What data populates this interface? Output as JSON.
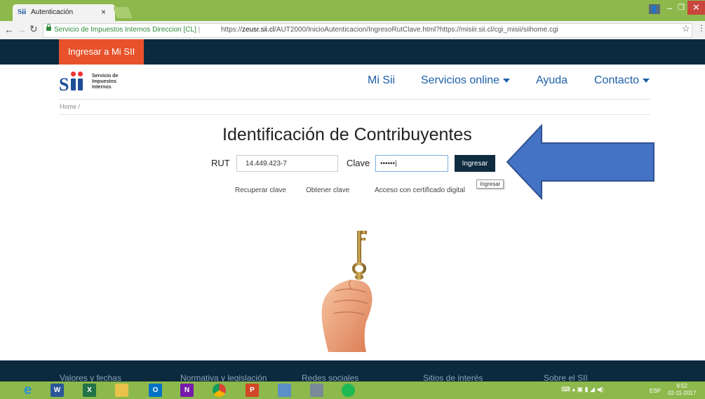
{
  "browser": {
    "tab_title": "Autenticación",
    "tab_logo": "Sii",
    "tab_close": "×",
    "secure_label": "Servicio de Impuestos Internos Direccion [CL]",
    "url_prefix": "https://",
    "url_host": "zeusr.sii.cl",
    "url_path": "/AUT2000/InicioAutenticacion/IngresoRutClave.html?https://misiir.sii.cl/cgi_misii/siihome.cgi",
    "window_user_icon": "user-icon",
    "star_glyph": "☆",
    "menu_glyph": "⋮"
  },
  "header": {
    "mi_sii_tab": "Ingresar a Mi SII",
    "logo_text": [
      "Servicio de",
      "Impuestos",
      "Internos"
    ],
    "nav": [
      {
        "label": "Mi Sii",
        "has_caret": false
      },
      {
        "label": "Servicios online",
        "has_caret": true
      },
      {
        "label": "Ayuda",
        "has_caret": false
      },
      {
        "label": "Contacto",
        "has_caret": true
      }
    ],
    "breadcrumb": "Home /"
  },
  "login": {
    "title": "Identificación de Contribuyentes",
    "rut_label": "RUT",
    "rut_value": "14.449.423-7",
    "clave_label": "Clave",
    "clave_value": "••••••|",
    "submit_label": "Ingresar",
    "tooltip": "Ingresar",
    "links": [
      "Recuperar clave",
      "Obtener clave",
      "Acceso con certificado digital"
    ]
  },
  "footer": {
    "links": [
      "Valores y fechas",
      "Normativa y legislación",
      "Redes sociales",
      "Sitios de interés",
      "Sobre el SII"
    ]
  },
  "taskbar": {
    "apps": [
      {
        "name": "internet-explorer-icon",
        "glyph": "e",
        "color": "#2a8fd6"
      },
      {
        "name": "word-icon",
        "glyph": "W",
        "color": "#2b579a"
      },
      {
        "name": "excel-icon",
        "glyph": "X",
        "color": "#217346"
      },
      {
        "name": "file-explorer-icon",
        "glyph": "",
        "color": "#e8c24a"
      },
      {
        "name": "outlook-icon",
        "glyph": "O",
        "color": "#0072c6"
      },
      {
        "name": "onenote-icon",
        "glyph": "N",
        "color": "#7719aa"
      },
      {
        "name": "chrome-icon",
        "glyph": "",
        "color": "#db4437"
      },
      {
        "name": "powerpoint-icon",
        "glyph": "P",
        "color": "#d24726"
      },
      {
        "name": "calculator-icon",
        "glyph": "",
        "color": "#5b8fc7"
      },
      {
        "name": "scanner-icon",
        "glyph": "",
        "color": "#7a8a99"
      },
      {
        "name": "spotify-icon",
        "glyph": "",
        "color": "#1db954"
      }
    ],
    "language": "ESP",
    "time": "9:52",
    "date": "02-11-2017"
  },
  "colors": {
    "dark_navy": "#0b2a3e",
    "orange": "#e8522b",
    "link_blue": "#1d5fa8",
    "arrow_blue": "#4472c4",
    "chrome_green": "#8db84c"
  }
}
